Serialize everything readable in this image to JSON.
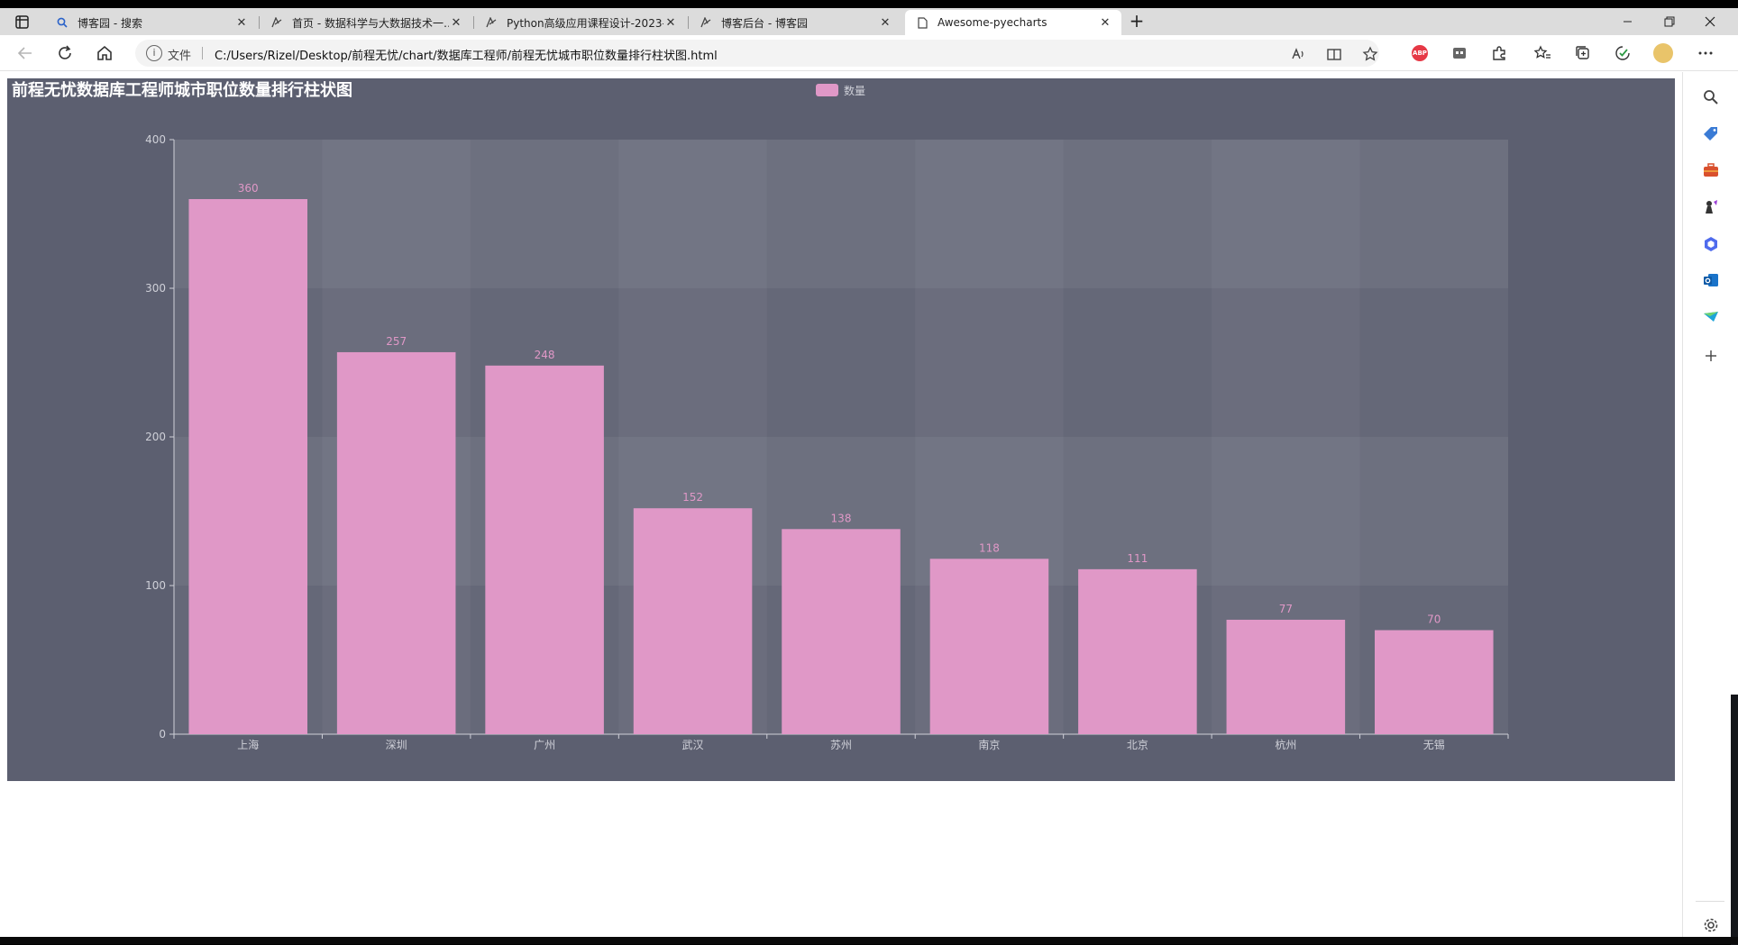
{
  "browser": {
    "tabs": [
      {
        "label": "博客园 - 搜索",
        "icon": "search-icon"
      },
      {
        "label": "首页 - 数据科学与大数据技术一…",
        "icon": "cnblogs-icon"
      },
      {
        "label": "Python高级应用课程设计-2023-…",
        "icon": "cnblogs-icon"
      },
      {
        "label": "博客后台 - 博客园",
        "icon": "cnblogs-icon"
      },
      {
        "label": "Awesome-pyecharts",
        "icon": "page-icon"
      }
    ],
    "close_glyph": "✕",
    "new_tab_glyph": "+",
    "address": {
      "file_label": "文件",
      "url": "C:/Users/Rizel/Desktop/前程无忧/chart/数据库工程师/前程无忧城市职位数量排行柱状图.html"
    },
    "abp_label": "ABP"
  },
  "colors": {
    "chart_bg": "#5c5f70",
    "bar": "#e098c7",
    "label": "#e098c7",
    "axis": "#cfd0d8",
    "title": "#ffffff"
  },
  "chart_data": {
    "type": "bar",
    "title": "前程无忧数据库工程师城市职位数量排行柱状图",
    "legend": [
      "数量"
    ],
    "legend_position": "top-center",
    "categories": [
      "上海",
      "深圳",
      "广州",
      "武汉",
      "苏州",
      "南京",
      "北京",
      "杭州",
      "无锡"
    ],
    "series": [
      {
        "name": "数量",
        "values": [
          360,
          257,
          248,
          152,
          138,
          118,
          111,
          77,
          70
        ]
      }
    ],
    "yticks": [
      0,
      100,
      200,
      300,
      400
    ],
    "ylim": [
      0,
      400
    ],
    "split_area": true,
    "xlabel": "",
    "ylabel": ""
  }
}
